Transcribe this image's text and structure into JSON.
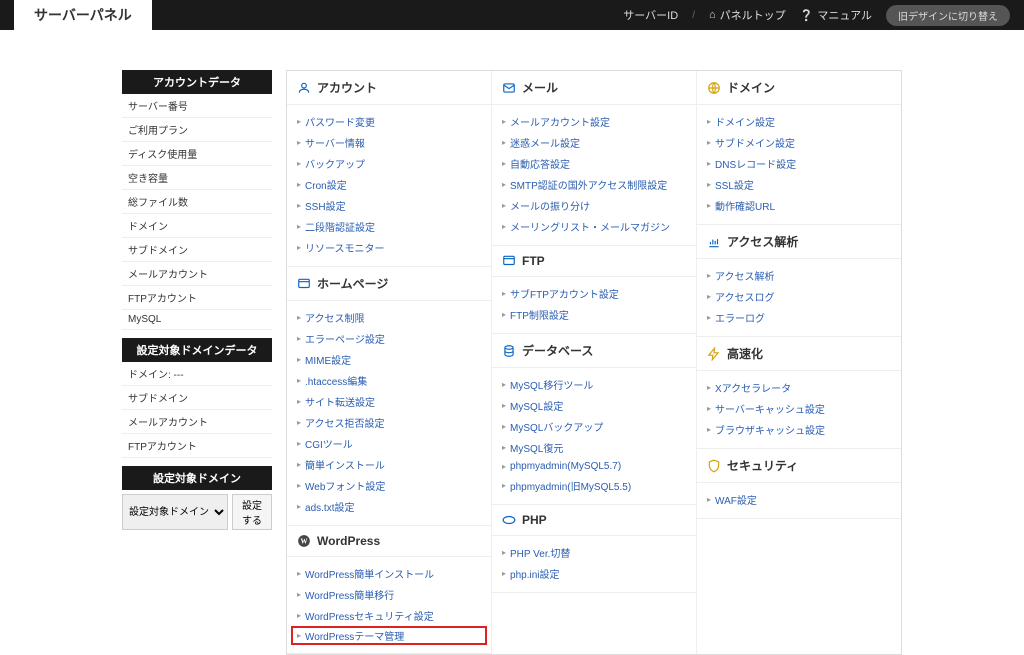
{
  "topbar": {
    "brand": "サーバーパネル",
    "server_label": "サーバーID",
    "panel_top": "パネルトップ",
    "manual": "マニュアル",
    "old_design": "旧デザインに切り替え"
  },
  "side": {
    "account_head": "アカウントデータ",
    "rows": [
      {
        "label": "サーバー番号",
        "val": ""
      },
      {
        "label": "ご利用プラン",
        "val": ""
      },
      {
        "label": "ディスク使用量",
        "val": ""
      },
      {
        "label": "空き容量",
        "val": ""
      },
      {
        "label": "総ファイル数",
        "val": ""
      },
      {
        "label": "ドメイン",
        "val": ""
      },
      {
        "label": "サブドメイン",
        "val": ""
      },
      {
        "label": "メールアカウント",
        "val": ""
      },
      {
        "label": "FTPアカウント",
        "val": ""
      },
      {
        "label": "MySQL",
        "val": ""
      }
    ],
    "domain_head": "設定対象ドメインデータ",
    "drows": [
      {
        "label": "ドメイン: ---",
        "val": ""
      },
      {
        "label": "サブドメイン",
        "val": ""
      },
      {
        "label": "メールアカウント",
        "val": ""
      },
      {
        "label": "FTPアカウント",
        "val": ""
      }
    ],
    "target_head": "設定対象ドメイン",
    "select_placeholder": "設定対象ドメイン",
    "set_btn": "設定する"
  },
  "cards": {
    "account": {
      "title": "アカウント",
      "items": [
        "パスワード変更",
        "サーバー情報",
        "バックアップ",
        "Cron設定",
        "SSH設定",
        "二段階認証設定",
        "リソースモニター"
      ]
    },
    "mail": {
      "title": "メール",
      "items": [
        "メールアカウント設定",
        "迷惑メール設定",
        "自動応答設定",
        "SMTP認証の国外アクセス制限設定",
        "メールの振り分け",
        "メーリングリスト・メールマガジン"
      ]
    },
    "domain": {
      "title": "ドメイン",
      "items": [
        "ドメイン設定",
        "サブドメイン設定",
        "DNSレコード設定",
        "SSL設定",
        "動作確認URL"
      ]
    },
    "homepage": {
      "title": "ホームページ",
      "items": [
        "アクセス制限",
        "エラーページ設定",
        "MIME設定",
        ".htaccess編集",
        "サイト転送設定",
        "アクセス拒否設定",
        "CGIツール",
        "簡単インストール",
        "Webフォント設定",
        "ads.txt設定"
      ]
    },
    "ftp": {
      "title": "FTP",
      "items": [
        "サブFTPアカウント設定",
        "FTP制限設定"
      ]
    },
    "access": {
      "title": "アクセス解析",
      "items": [
        "アクセス解析",
        "アクセスログ",
        "エラーログ"
      ]
    },
    "wordpress": {
      "title": "WordPress",
      "items": [
        "WordPress簡単インストール",
        "WordPress簡単移行",
        "WordPressセキュリティ設定",
        "WordPressテーマ管理"
      ],
      "highlight": 3
    },
    "database": {
      "title": "データベース",
      "items": [
        "MySQL移行ツール",
        "MySQL設定",
        "MySQLバックアップ",
        "MySQL復元",
        "phpmyadmin(MySQL5.7)",
        "phpmyadmin(旧MySQL5.5)"
      ]
    },
    "speed": {
      "title": "高速化",
      "items": [
        "Xアクセラレータ",
        "サーバーキャッシュ設定",
        "ブラウザキャッシュ設定"
      ]
    },
    "php": {
      "title": "PHP",
      "items": [
        "PHP Ver.切替",
        "php.ini設定"
      ]
    },
    "security": {
      "title": "セキュリティ",
      "items": [
        "WAF設定"
      ]
    }
  }
}
